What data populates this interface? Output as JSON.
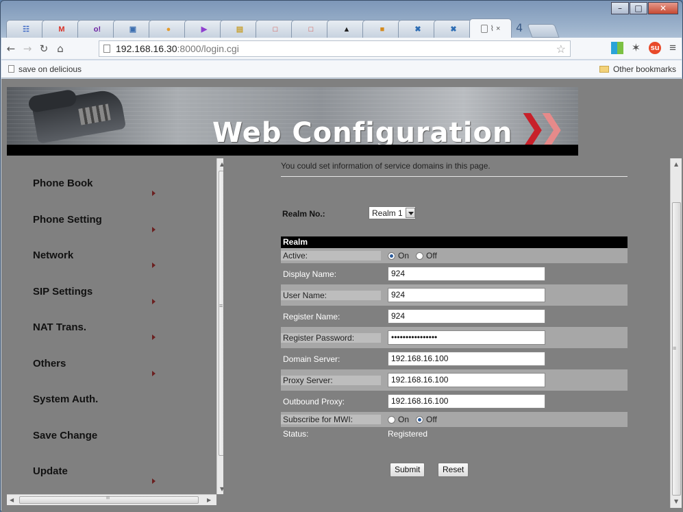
{
  "browser": {
    "tab_count": "4",
    "active_tab_label": "⌇ ×",
    "url_host": "192.168.16.30",
    "url_path": ":8000/login.cgi",
    "bookmark_left": "save on delicious",
    "bookmark_right": "Other bookmarks",
    "tabs": [
      {
        "icon": "delicious-icon",
        "glyph": "☷",
        "color": "#3a66c4"
      },
      {
        "icon": "gmail-icon",
        "glyph": "M",
        "color": "#d93025"
      },
      {
        "icon": "yahoo-icon",
        "glyph": "o!",
        "color": "#6b1fa0"
      },
      {
        "icon": "app-icon",
        "glyph": "▣",
        "color": "#3d6fb0"
      },
      {
        "icon": "orange-icon",
        "glyph": "●",
        "color": "#e59b2b"
      },
      {
        "icon": "purple-icon",
        "glyph": "▶",
        "color": "#8f3fcf"
      },
      {
        "icon": "image-icon",
        "glyph": "▤",
        "color": "#c7a235"
      },
      {
        "icon": "red-window-icon",
        "glyph": "□",
        "color": "#d2453a"
      },
      {
        "icon": "red-window-icon",
        "glyph": "□",
        "color": "#d2453a"
      },
      {
        "icon": "penguin-icon",
        "glyph": "▲",
        "color": "#222222"
      },
      {
        "icon": "photo-icon",
        "glyph": "■",
        "color": "#d48a1e"
      },
      {
        "icon": "blue-x-icon",
        "glyph": "✖",
        "color": "#2c6cb3"
      },
      {
        "icon": "blue-x-icon",
        "glyph": "✖",
        "color": "#2c6cb3"
      }
    ]
  },
  "banner": {
    "title": "Web Configuration",
    "chevron": "❯❯"
  },
  "menu": {
    "items": [
      {
        "label": "Phone Book",
        "arrow": true
      },
      {
        "label": "Phone Setting",
        "arrow": true
      },
      {
        "label": "Network",
        "arrow": true
      },
      {
        "label": "SIP Settings",
        "arrow": true
      },
      {
        "label": "NAT Trans.",
        "arrow": true
      },
      {
        "label": "Others",
        "arrow": true
      },
      {
        "label": "System Auth.",
        "arrow": false
      },
      {
        "label": "Save Change",
        "arrow": false
      },
      {
        "label": "Update",
        "arrow": true
      }
    ]
  },
  "form": {
    "intro": "You could set information of service domains in this page.",
    "realm_no_label": "Realm No.:",
    "realm_selected": "Realm 1",
    "table_header": "Realm",
    "active_label": "Active:",
    "active_on": "On",
    "active_off": "Off",
    "display_name_label": "Display Name:",
    "display_name_value": "924",
    "user_name_label": "User Name:",
    "user_name_value": "924",
    "register_name_label": "Register Name:",
    "register_name_value": "924",
    "register_password_label": "Register Password:",
    "register_password_value": "••••••••••••••••",
    "domain_server_label": "Domain Server:",
    "domain_server_value": "192.168.16.100",
    "proxy_server_label": "Proxy Server:",
    "proxy_server_value": "192.168.16.100",
    "outbound_proxy_label": "Outbound Proxy:",
    "outbound_proxy_value": "192.168.16.100",
    "mwi_label": "Subscribe for MWI:",
    "mwi_on": "On",
    "mwi_off": "Off",
    "status_label": "Status:",
    "status_value": "Registered",
    "submit_label": "Submit",
    "reset_label": "Reset"
  }
}
